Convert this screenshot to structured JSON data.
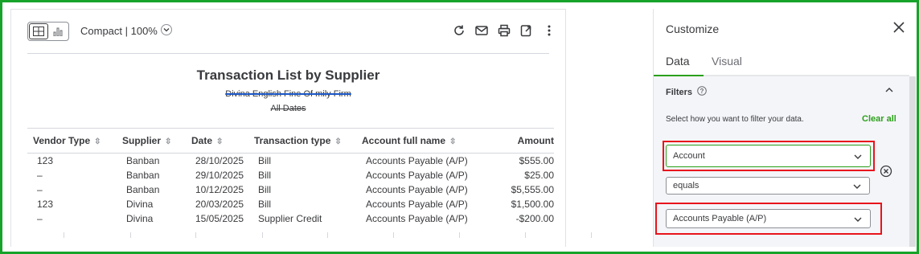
{
  "toolbar": {
    "density_label": "Compact | 100%"
  },
  "report": {
    "title": "Transaction List by Supplier",
    "company": "Divina English Fine Of mily Firm",
    "dates": "All Dates",
    "columns": [
      "Vendor Type",
      "Supplier",
      "Date",
      "Transaction type",
      "Account full name",
      "Amount"
    ],
    "rows": [
      [
        "123",
        "Banban",
        "28/10/2025",
        "Bill",
        "Accounts Payable (A/P)",
        "$555.00"
      ],
      [
        "–",
        "Banban",
        "29/10/2025",
        "Bill",
        "Accounts Payable (A/P)",
        "$25.00"
      ],
      [
        "–",
        "Banban",
        "10/12/2025",
        "Bill",
        "Accounts Payable (A/P)",
        "$5,555.00"
      ],
      [
        "123",
        "Divina",
        "20/03/2025",
        "Bill",
        "Accounts Payable (A/P)",
        "$1,500.00"
      ],
      [
        "–",
        "Divina",
        "15/05/2025",
        "Supplier Credit",
        "Accounts Payable (A/P)",
        "-$200.00"
      ]
    ]
  },
  "panel": {
    "title": "Customize",
    "tabs": [
      "Data",
      "Visual"
    ],
    "filters_heading": "Filters",
    "filter_hint": "Select how you want to filter your data.",
    "clear_all": "Clear all",
    "filter_field": "Account",
    "filter_operator": "equals",
    "filter_value": "Accounts Payable (A/P)"
  },
  "colors": {
    "accent_green": "#2ca01c",
    "highlight_red": "#e8141c",
    "frame_green": "#17a32a"
  }
}
